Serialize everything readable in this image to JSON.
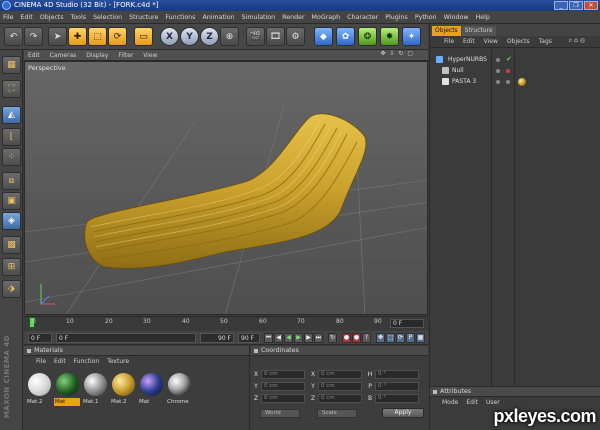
{
  "window": {
    "title": "CINEMA 4D Studio (32 Bit) - [FORK.c4d *]",
    "controls": [
      "_",
      "❐",
      "✕"
    ]
  },
  "menu": [
    "File",
    "Edit",
    "Objects",
    "Tools",
    "Selection",
    "Structure",
    "Functions",
    "Animation",
    "Simulation",
    "Render",
    "MoGraph",
    "Character",
    "Plugins",
    "Python",
    "Window",
    "Help"
  ],
  "toolbar": {
    "undo_icon": "↶",
    "redo_icon": "↷",
    "live_select_icon": "➤",
    "move_icon": "✚",
    "scale_icon": "⬚",
    "rotate_icon": "⟳",
    "frame_icon": "▭",
    "axis_x": "X",
    "axis_y": "Y",
    "axis_z": "Z",
    "coord_icon": "⊕",
    "render_view_icon": "🎬",
    "render_pv_icon": "🎞",
    "render_settings_icon": "⚙",
    "cube_icon": "◆",
    "spline_icon": "✿",
    "nurbs_icon": "❂",
    "array_icon": "✸",
    "deformer_icon": "✦",
    "scene_icon": "⬮",
    "light_icon": "✺"
  },
  "viewport": {
    "menu": [
      "Edit",
      "Cameras",
      "Display",
      "Filter",
      "View"
    ],
    "label": "Perspective",
    "nav_icons": "✥ ⇩ ↻ ▢"
  },
  "timeline": {
    "ticks": [
      "0",
      "10",
      "20",
      "30",
      "40",
      "50",
      "60",
      "70",
      "80",
      "90"
    ],
    "current_frame": "0 F",
    "start": "0 F",
    "min_field": "0 F",
    "max_field": "90 F",
    "end": "90 F"
  },
  "materials": {
    "title": "Materials",
    "menu": [
      "File",
      "Edit",
      "Function",
      "Texture"
    ],
    "items": [
      {
        "label": "Mat.2",
        "color": "#f4f4f4",
        "selected": false
      },
      {
        "label": "Mat",
        "color": "#1d5a1d",
        "selected": true
      },
      {
        "label": "Mat.1",
        "color": "#9a9a9a",
        "selected": false
      },
      {
        "label": "Mat.2",
        "color": "#c69a2e",
        "selected": false
      },
      {
        "label": "Mat",
        "color": "#2b3f8f",
        "selected": false
      },
      {
        "label": "Chrome",
        "color": "#aaaaaa",
        "selected": false
      }
    ]
  },
  "coordinates": {
    "title": "Coordinates",
    "rows": [
      {
        "a": "X",
        "v1": "0 cm",
        "b": "X",
        "v2": "0 cm",
        "c": "H",
        "v3": "0 °"
      },
      {
        "a": "Y",
        "v1": "0 cm",
        "b": "Y",
        "v2": "0 cm",
        "c": "P",
        "v3": "0 °"
      },
      {
        "a": "Z",
        "v1": "0 cm",
        "b": "Z",
        "v2": "0 cm",
        "c": "B",
        "v3": "0 °"
      }
    ],
    "mode1": "World",
    "mode2": "Scale",
    "apply": "Apply"
  },
  "objects": {
    "tabs": [
      "Objects",
      "Structure"
    ],
    "menu": [
      "File",
      "Edit",
      "View",
      "Objects",
      "Tags"
    ],
    "rows": [
      {
        "name": "HyperNURBS",
        "icon_color": "#6ab0ff"
      },
      {
        "name": "Null",
        "icon_color": "#c0c0c0"
      },
      {
        "name": "PASTA 3",
        "icon_color": "#e0e0e0"
      }
    ]
  },
  "attributes": {
    "title": "Attributes",
    "menu": [
      "Mode",
      "Edit",
      "User"
    ]
  },
  "branding": {
    "side_logo": "MAXON CINEMA 4D",
    "watermark": "pxleyes.com"
  }
}
